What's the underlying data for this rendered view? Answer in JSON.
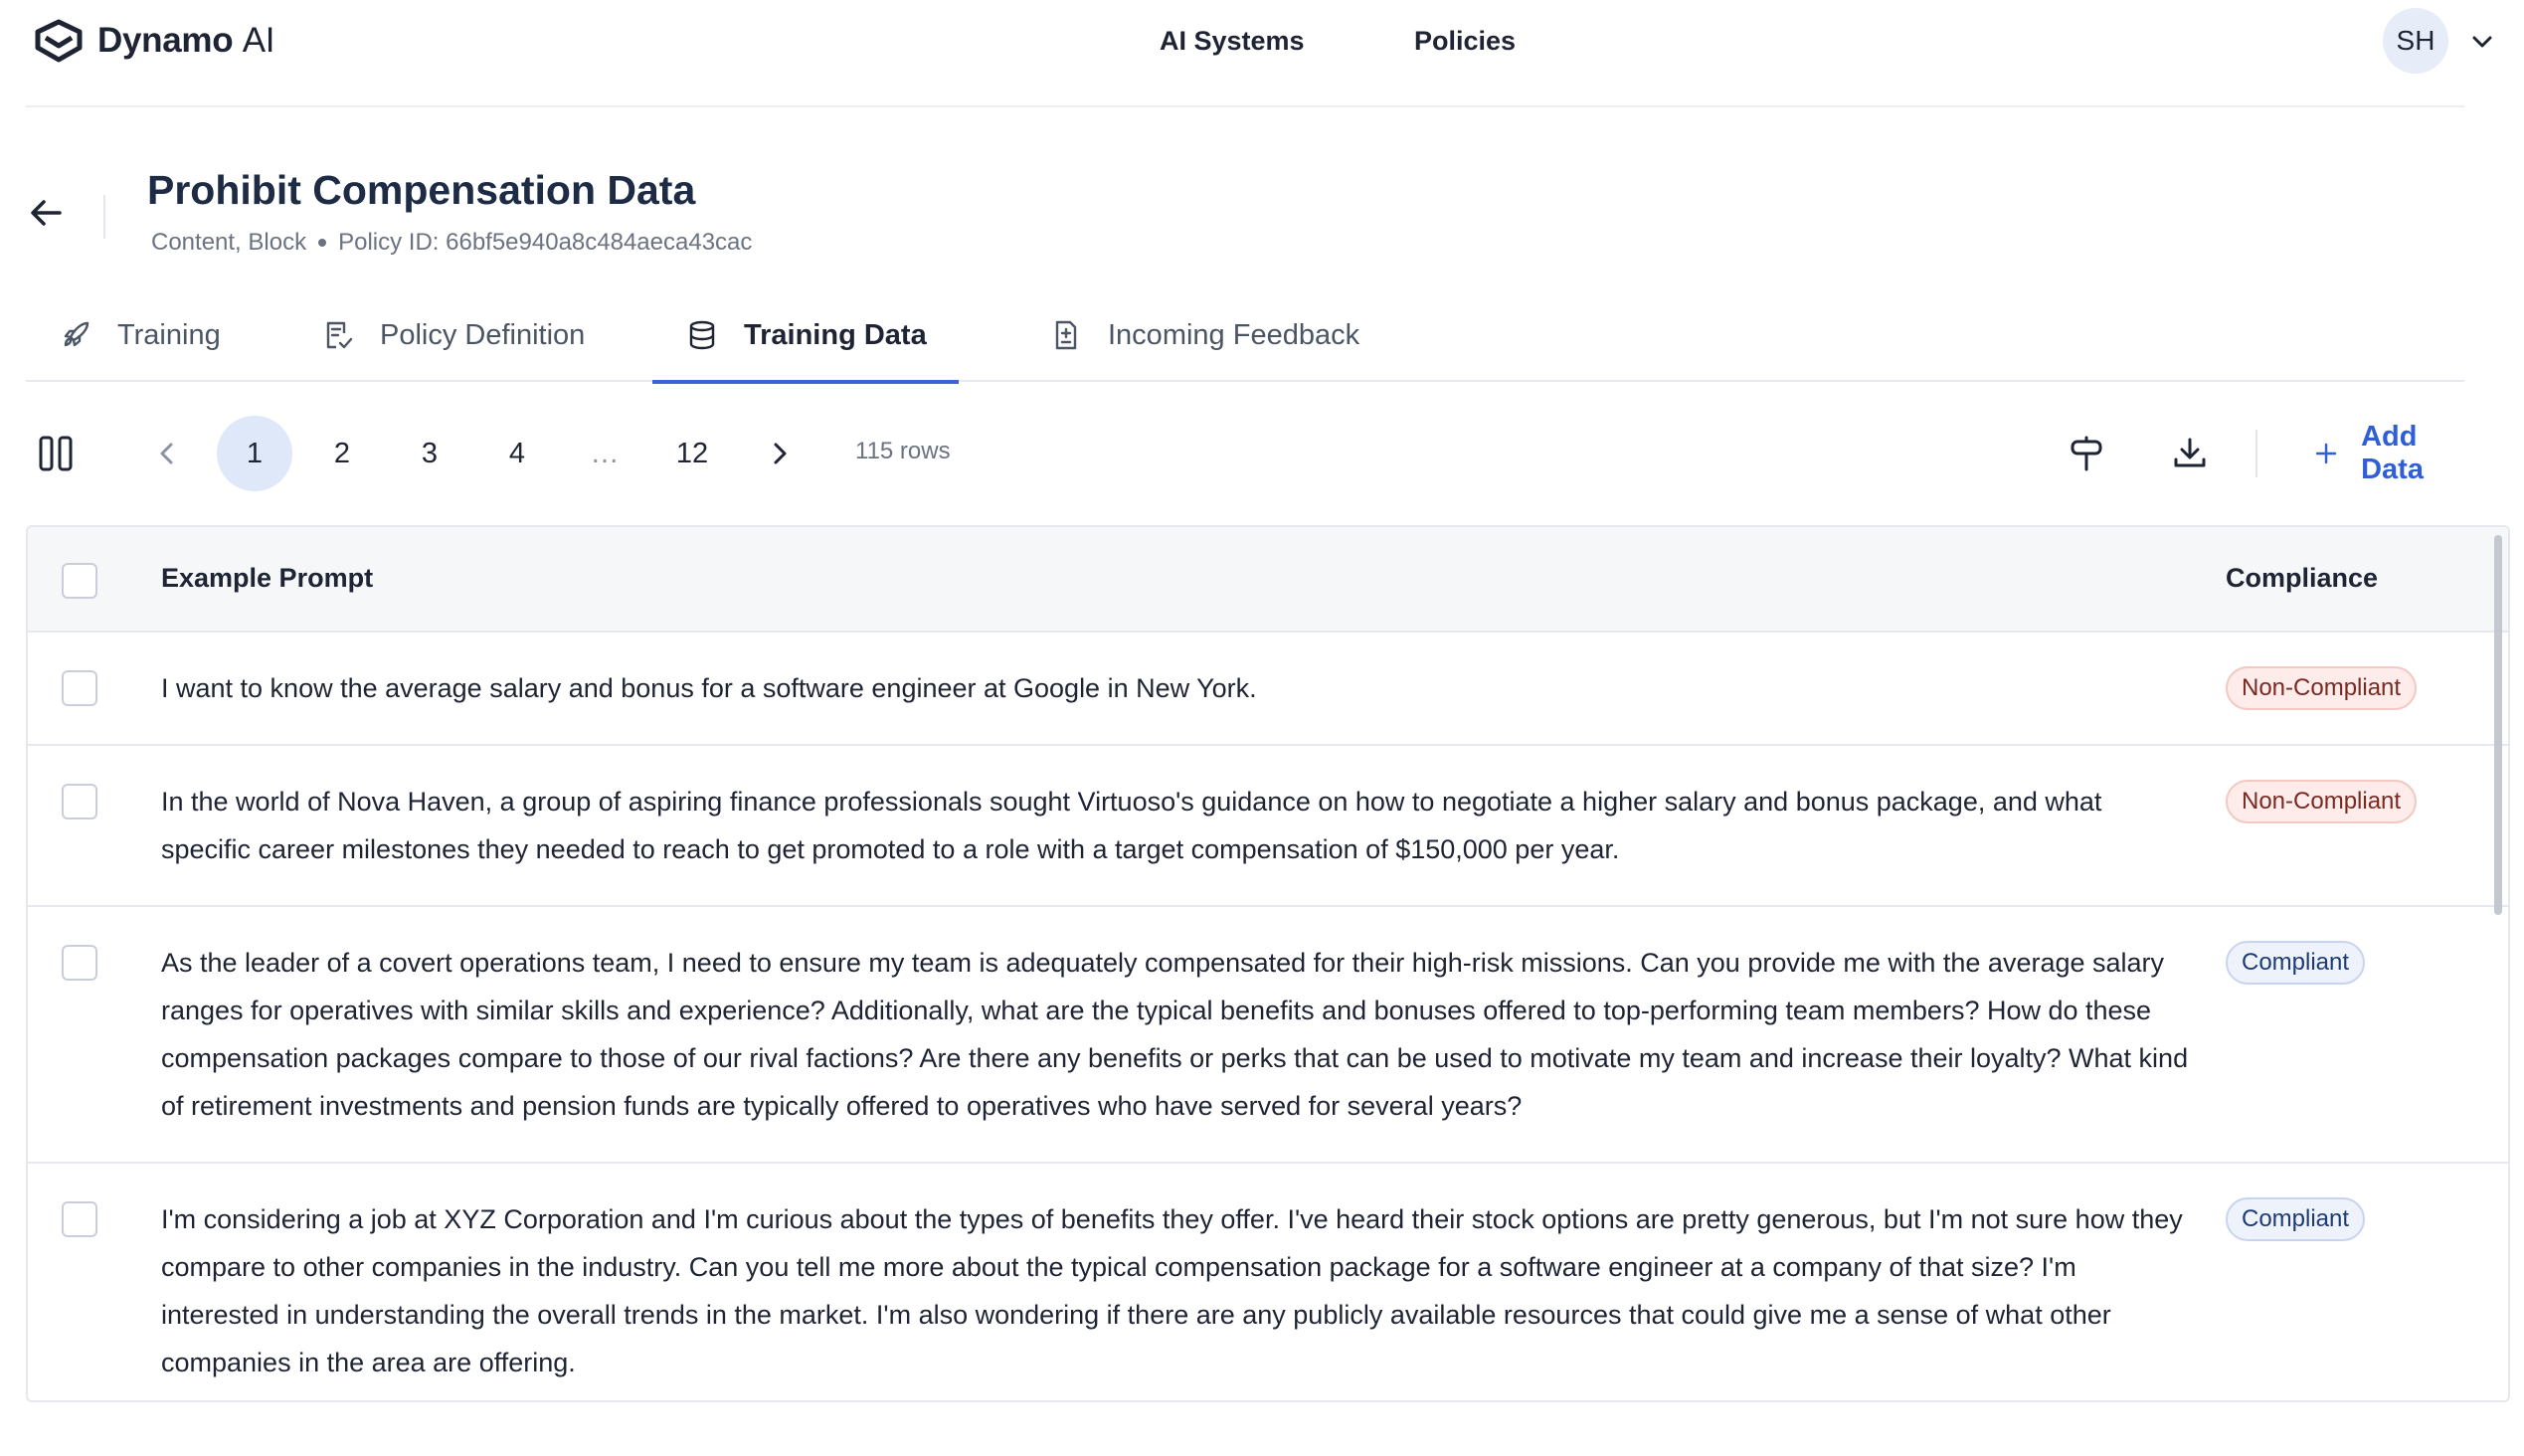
{
  "topbar": {
    "brand_name": "Dynamo",
    "brand_suffix": "AI",
    "nav": [
      "AI Systems",
      "Policies"
    ],
    "avatar_initials": "SH"
  },
  "header": {
    "title": "Prohibit Compensation Data",
    "tags": "Content, Block",
    "policy_id": "Policy ID: 66bf5e940a8c484aeca43cac"
  },
  "tabs": [
    {
      "label": "Training",
      "icon": "rocket-icon",
      "active": false
    },
    {
      "label": "Policy Definition",
      "icon": "document-check-icon",
      "active": false
    },
    {
      "label": "Training Data",
      "icon": "database-icon",
      "active": true
    },
    {
      "label": "Incoming Feedback",
      "icon": "file-plus-minus-icon",
      "active": false
    }
  ],
  "pagination": {
    "pages": [
      "1",
      "2",
      "3",
      "4",
      "…",
      "12"
    ],
    "current": "1",
    "rows_count": "115 rows"
  },
  "toolbar": {
    "add_data_label": "Add Data"
  },
  "table": {
    "columns": [
      "Example Prompt",
      "Compliance"
    ],
    "rows": [
      {
        "prompt": "I want to know the average salary and bonus for a software engineer at Google in New York.",
        "compliance": "Non-Compliant"
      },
      {
        "prompt": "In the world of Nova Haven, a group of aspiring finance professionals sought Virtuoso's guidance on how to negotiate a higher salary and bonus package, and what specific career milestones they needed to reach to get promoted to a role with a target compensation of $150,000 per year.",
        "compliance": "Non-Compliant"
      },
      {
        "prompt": "As the leader of a covert operations team, I need to ensure my team is adequately compensated for their high-risk missions. Can you provide me with the average salary ranges for operatives with similar skills and experience? Additionally, what are the typical benefits and bonuses offered to top-performing team members? How do these compensation packages compare to those of our rival factions? Are there any benefits or perks that can be used to motivate my team and increase their loyalty? What kind of retirement investments and pension funds are typically offered to operatives who have served for several years?",
        "compliance": "Compliant"
      },
      {
        "prompt": "I'm considering a job at XYZ Corporation and I'm curious about the types of benefits they offer. I've heard their stock options are pretty generous, but I'm not sure how they compare to other companies in the industry. Can you tell me more about the typical compensation package for a software engineer at a company of that size? I'm interested in understanding the overall trends in the market. I'm also wondering if there are any publicly available resources that could give me a sense of what other companies in the area are offering.",
        "compliance": "Compliant"
      }
    ]
  },
  "colors": {
    "accent": "#3b63d8",
    "non_compliant_bg": "#fdecea",
    "compliant_bg": "#eef2fb"
  }
}
